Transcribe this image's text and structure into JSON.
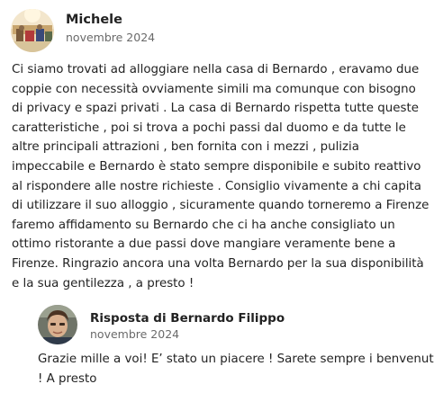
{
  "review": {
    "author_name": "Michele",
    "date": "novembre 2024",
    "body_lines": [
      "Ci siamo trovati ad alloggiare nella casa di Bernardo , eravamo due",
      "coppie con necessità ovviamente simili ma comunque con bisogno",
      "di privacy e spazi privati . La casa di Bernardo rispetta tutte queste",
      "caratteristiche , poi si trova a pochi passi dal duomo e da tutte le",
      "altre principali attrazioni , ben fornita con i mezzi , pulizia",
      "impeccabile e Bernardo è stato sempre disponibile e subito reattivo",
      "al rispondere alle nostre richieste . Consiglio vivamente a chi capita",
      "di utilizzare il suo alloggio , sicuramente quando torneremo a Firenze",
      "faremo affidamento su Bernardo che ci ha anche consigliato un",
      "ottimo ristorante a due passi dove mangiare veramente bene a",
      "Firenze. Ringrazio ancora una volta Bernardo per la sua disponibilità",
      "e la sua gentilezza , a presto !"
    ]
  },
  "reply": {
    "title": "Risposta di Bernardo Filippo",
    "date": "novembre 2024",
    "body_lines": [
      "Grazie mille a voi! E’ stato un piacere ! Sarete sempre i benvenuti",
      "! A presto"
    ]
  }
}
